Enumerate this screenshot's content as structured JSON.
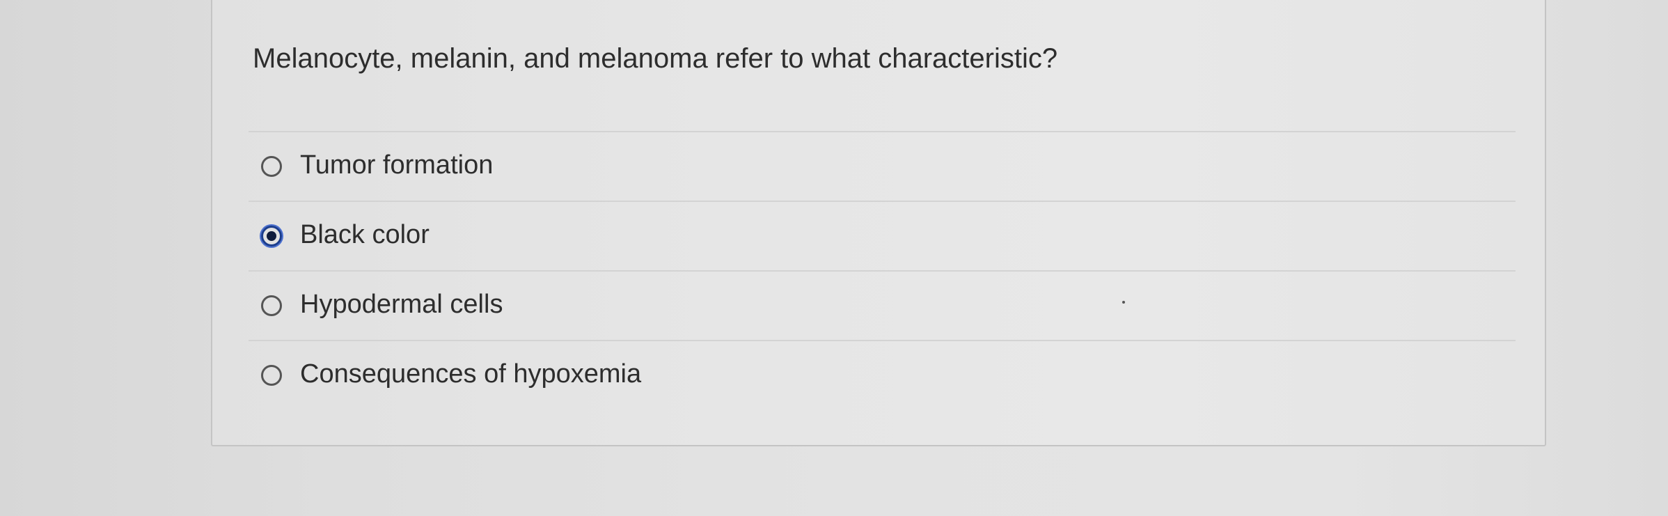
{
  "question": {
    "text": "Melanocyte, melanin, and melanoma refer to what characteristic?"
  },
  "options": [
    {
      "label": "Tumor formation",
      "selected": false
    },
    {
      "label": "Black color",
      "selected": true
    },
    {
      "label": "Hypodermal cells",
      "selected": false
    },
    {
      "label": "Consequences of hypoxemia",
      "selected": false
    }
  ],
  "colors": {
    "selected_radio_ring": "#1a3c8c",
    "selected_radio_dot": "#101c3c",
    "text": "#2d2d2d"
  }
}
